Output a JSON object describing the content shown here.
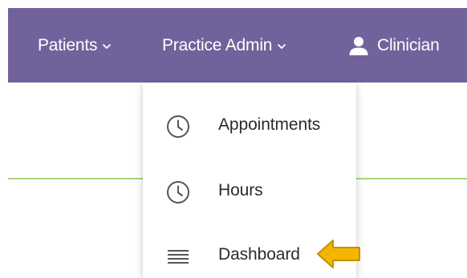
{
  "nav": {
    "patients_label": "Patients",
    "practice_admin_label": "Practice Admin",
    "clinician_label": "Clinician"
  },
  "dropdown": {
    "items": [
      {
        "label": "Appointments",
        "icon": "clock-icon"
      },
      {
        "label": "Hours",
        "icon": "clock-icon"
      },
      {
        "label": "Dashboard",
        "icon": "list-icon"
      }
    ]
  },
  "colors": {
    "topbar": "#72629c",
    "divider": "#a9d27a",
    "arrow_fill": "#f2b600",
    "arrow_stroke": "#c98f00"
  }
}
